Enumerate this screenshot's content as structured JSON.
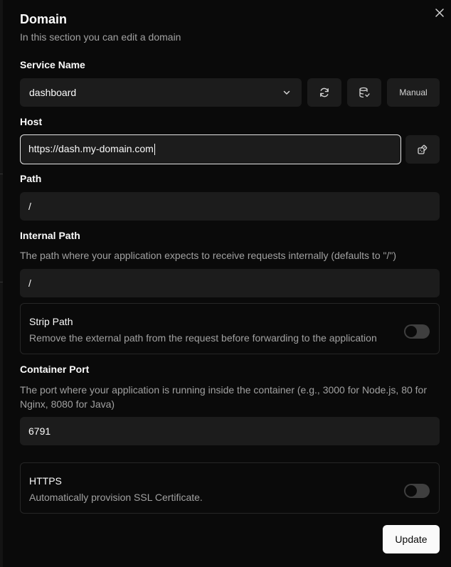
{
  "dialog": {
    "title": "Domain",
    "subtitle": "In this section you can edit a domain",
    "close_icon": "close-icon"
  },
  "service": {
    "label": "Service Name",
    "selected_value": "dashboard",
    "refresh_icon": "refresh-icon",
    "database_icon": "database-icon",
    "manual_label": "Manual"
  },
  "host": {
    "label": "Host",
    "value": "https://dash.my-domain.com",
    "generate_icon": "dice-icon"
  },
  "path": {
    "label": "Path",
    "value": "/"
  },
  "internal_path": {
    "label": "Internal Path",
    "help": "The path where your application expects to receive requests internally (defaults to \"/\")",
    "value": "/"
  },
  "strip_path": {
    "title": "Strip Path",
    "description": "Remove the external path from the request before forwarding to the application",
    "enabled": false
  },
  "container_port": {
    "label": "Container Port",
    "help": "The port where your application is running inside the container (e.g., 3000 for Node.js, 80 for Nginx, 8080 for Java)",
    "value": "6791"
  },
  "https": {
    "title": "HTTPS",
    "description": "Automatically provision SSL Certificate.",
    "enabled": false
  },
  "actions": {
    "update_label": "Update"
  },
  "colors": {
    "background": "#0a0a0a",
    "input_bg": "#1c1c1c",
    "muted_text": "#a1a1a1",
    "primary_button": "#fafafa"
  }
}
